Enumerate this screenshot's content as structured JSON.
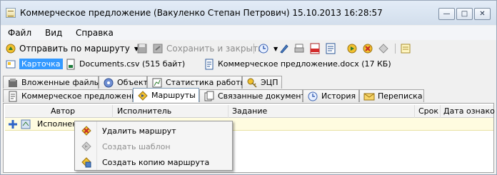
{
  "window": {
    "title": "Коммерческое предложение (Вакуленко Степан Петрович) 15.10.2013 16:28:57",
    "minimize_glyph": "—",
    "maximize_glyph": "□",
    "close_glyph": "✕"
  },
  "menu": [
    "Файл",
    "Вид",
    "Справка"
  ],
  "toolbar": {
    "send_route_label": "Отправить по маршруту",
    "save_close_label": "Сохранить и закрыть"
  },
  "attachments": {
    "card_label": "Карточка",
    "file1": "Documents.csv (515 байт)",
    "file2": "Коммерческое предложение.docx (17 КБ)"
  },
  "tabs_top": [
    "Вложенные файлы",
    "Объект",
    "Статистика работы",
    "ЭЦП"
  ],
  "tabs_bottom": [
    "Коммерческое предложение",
    "Маршруты",
    "Связанные документы",
    "История",
    "Переписка"
  ],
  "grid": {
    "columns": [
      "Автор",
      "Исполнитель",
      "Задание",
      "Срок",
      "Дата ознако"
    ],
    "row_label": "Исполнени"
  },
  "context_menu": [
    "Удалить маршрут",
    "Создать шаблон",
    "Создать копию маршрута"
  ],
  "colors": {
    "accent": "#3399ff",
    "row_highlight": "#fffce0",
    "disabled_text": "#8d8d8d"
  }
}
